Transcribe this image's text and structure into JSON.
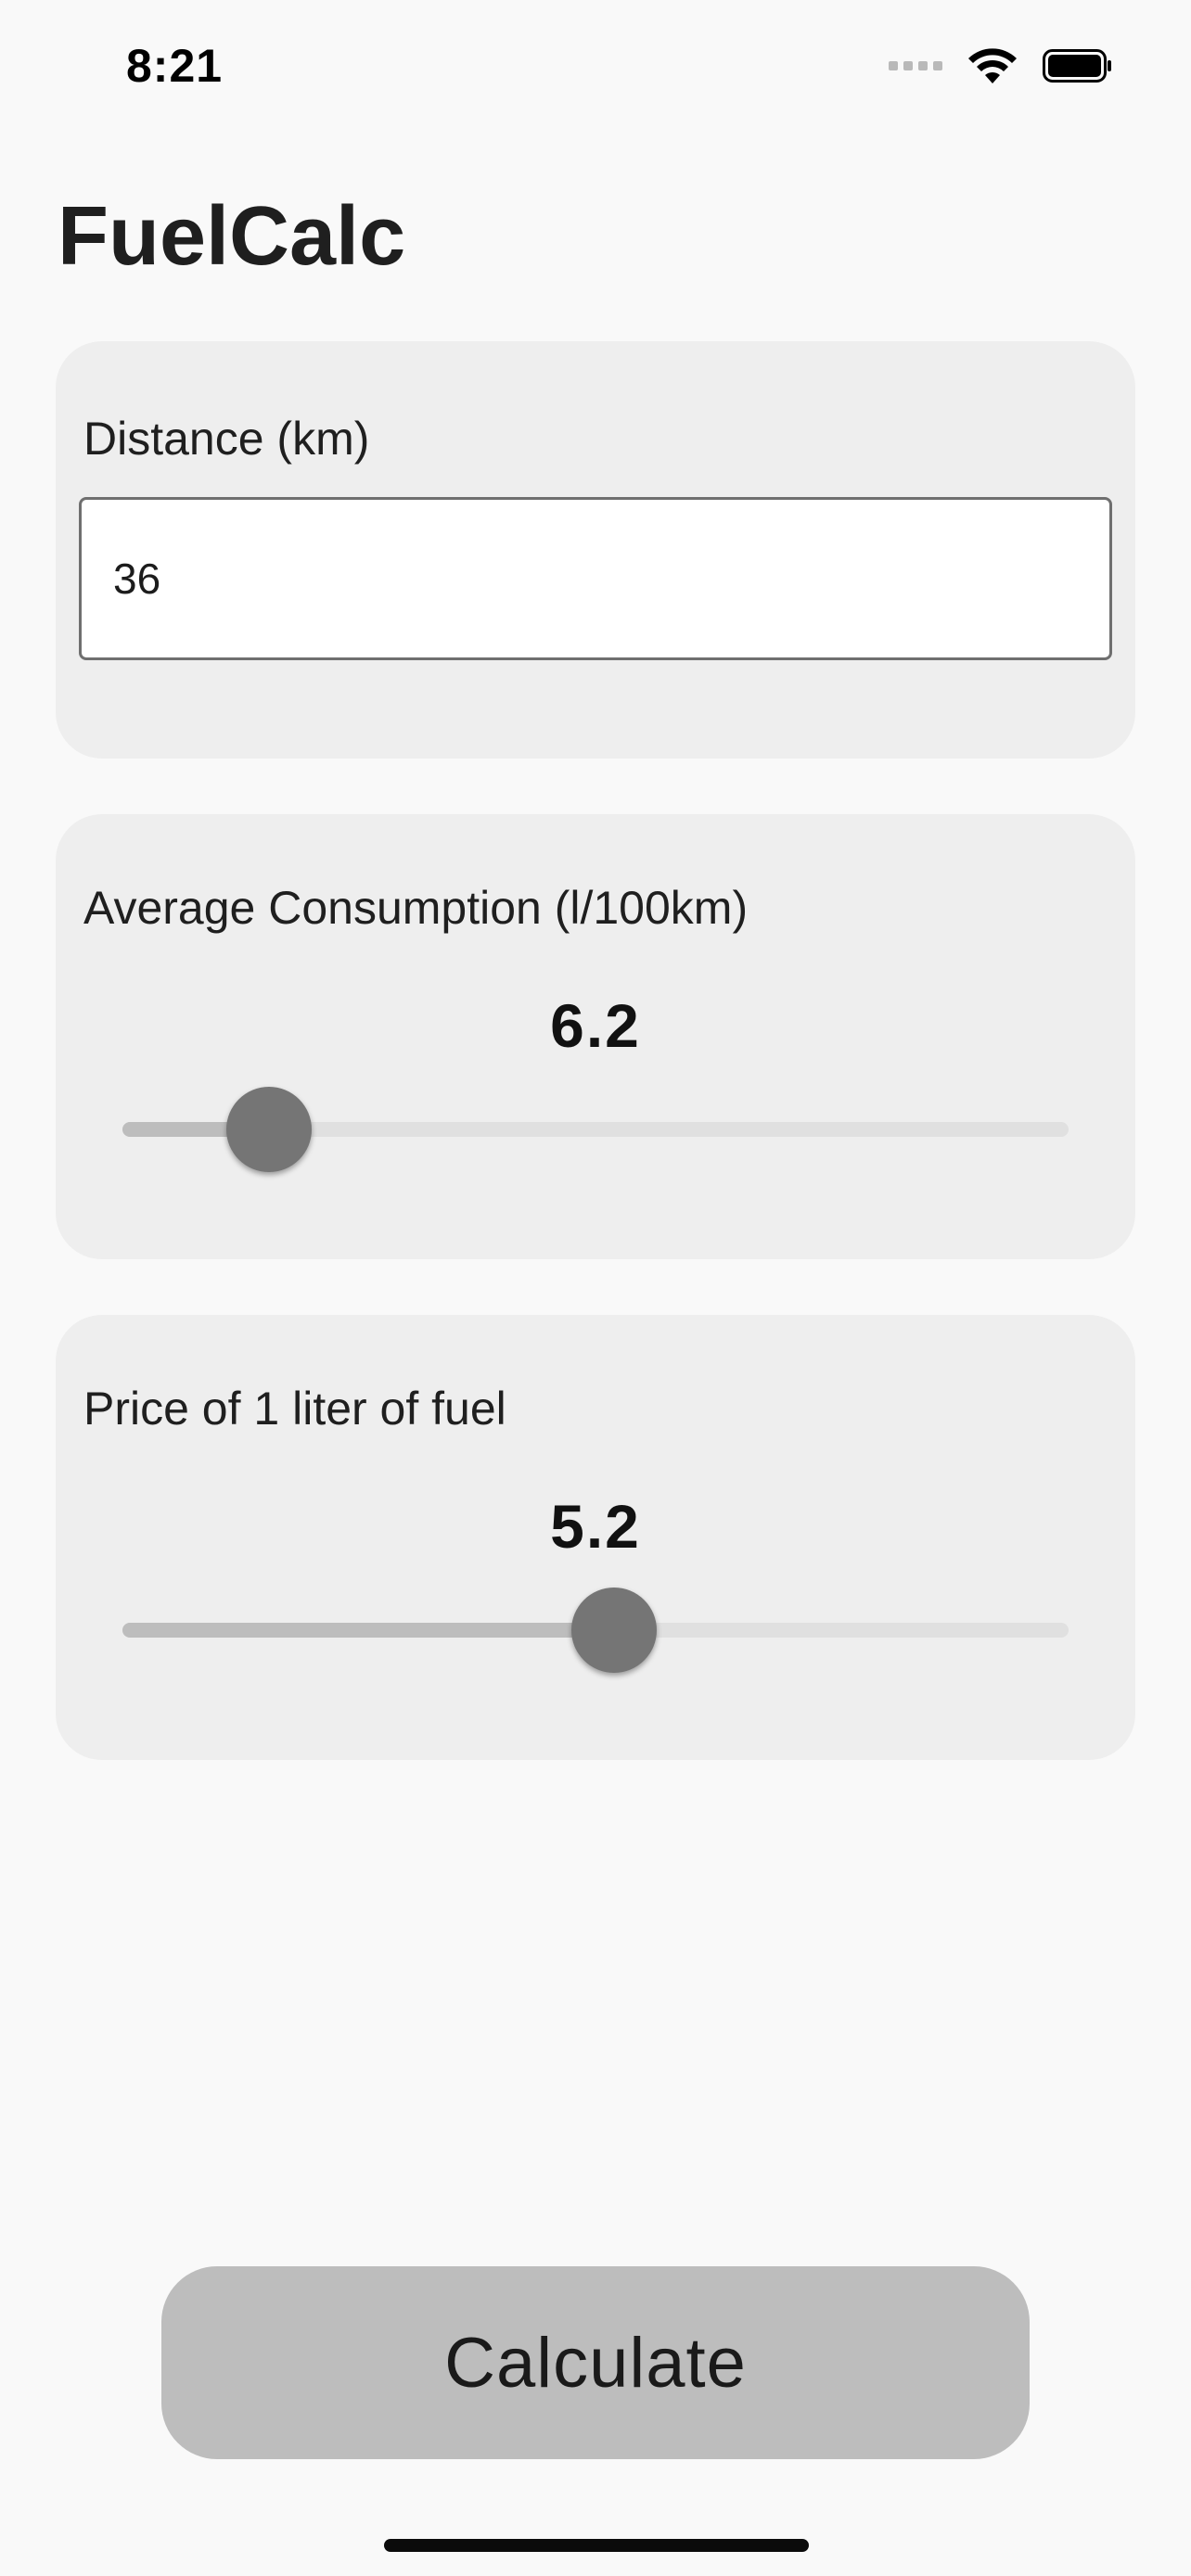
{
  "status_bar": {
    "time": "8:21",
    "icons": [
      "cellular-signal-icon",
      "wifi-icon",
      "battery-icon"
    ]
  },
  "app": {
    "title": "FuelCalc"
  },
  "distance": {
    "label": "Distance (km)",
    "value": "36"
  },
  "consumption": {
    "label": "Average Consumption (l/100km)",
    "value": "6.2",
    "slider_fraction": 0.155
  },
  "price": {
    "label": "Price of 1 liter of fuel",
    "value": "5.2",
    "slider_fraction": 0.52
  },
  "actions": {
    "calculate_label": "Calculate"
  },
  "colors": {
    "background": "#f9f9f9",
    "card": "#eeeeee",
    "thumb": "#757575",
    "track_fill": "#bdbdbd",
    "track": "#e0e0e0",
    "button": "#bdbdbd"
  }
}
